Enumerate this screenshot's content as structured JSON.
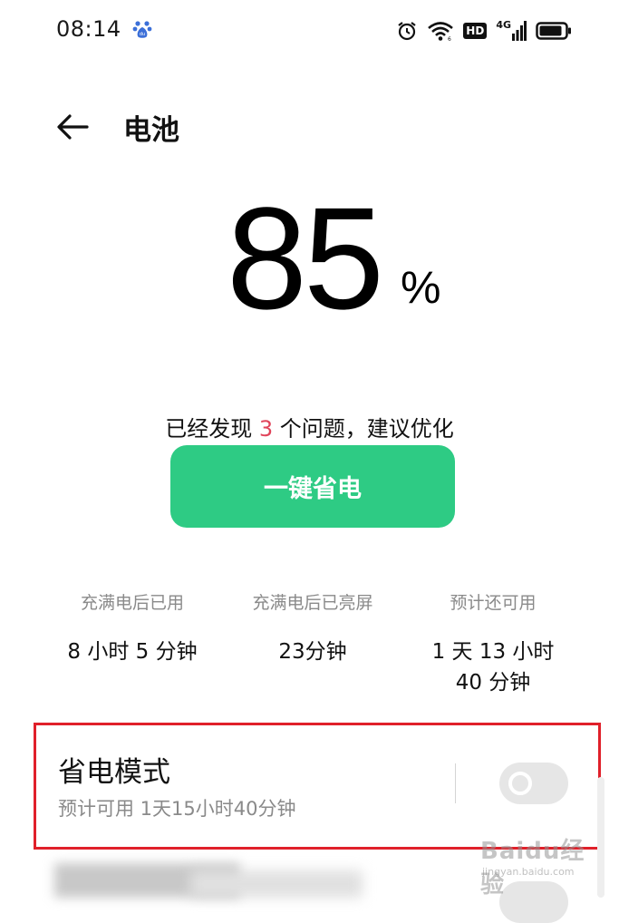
{
  "status_bar": {
    "time": "08:14",
    "app_icon": "baidu-paw-icon",
    "icons": [
      "alarm-icon",
      "wifi-icon",
      "hd-icon",
      "signal-4g-icon",
      "battery-icon"
    ],
    "hd_label": "HD",
    "network_label": "4G"
  },
  "header": {
    "back_icon": "arrow-left-icon",
    "title": "电池"
  },
  "battery": {
    "percent": "85",
    "unit": "%"
  },
  "issues": {
    "prefix": "已经发现",
    "count": "3",
    "suffix": "个问题，建议优化"
  },
  "optimize_button": {
    "label": "一键省电",
    "color": "#2ecb84"
  },
  "stats": [
    {
      "label": "充满电后已用",
      "value": "8 小时 5 分钟"
    },
    {
      "label": "充满电后已亮屏",
      "value": "23分钟"
    },
    {
      "label": "预计还可用",
      "value": "1 天 13 小时\n40 分钟"
    }
  ],
  "power_saving_mode": {
    "title": "省电模式",
    "subtitle": "预计可用 1天15小时40分钟",
    "enabled": false
  },
  "highlight_color": "#e0202a",
  "watermark": {
    "main": "Baidu经验",
    "sub": "jingyan.baidu.com"
  }
}
